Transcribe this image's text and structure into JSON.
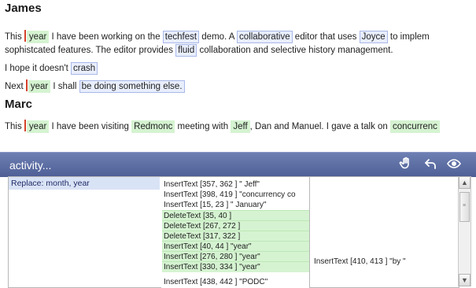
{
  "document": {
    "sections": [
      {
        "author": "James",
        "lines": [
          [
            {
              "t": "This ",
              "k": ""
            },
            {
              "t": "",
              "k": "bar"
            },
            {
              "t": "year",
              "k": "green"
            },
            {
              "t": " I have been working on the ",
              "k": ""
            },
            {
              "t": "techfest",
              "k": "blue"
            },
            {
              "t": " demo. A ",
              "k": ""
            },
            {
              "t": "collaborative",
              "k": "blue"
            },
            {
              "t": " editor that uses ",
              "k": ""
            },
            {
              "t": "Joyce",
              "k": "blue"
            },
            {
              "t": " to implem",
              "k": ""
            }
          ],
          [
            {
              "t": "sophistcated features. The editor provides ",
              "k": ""
            },
            {
              "t": "fluid",
              "k": "blue"
            },
            {
              "t": " collaboration and selective history management.",
              "k": ""
            }
          ],
          [
            {
              "t": "I hope it doesn't ",
              "k": ""
            },
            {
              "t": "crash",
              "k": "blue"
            }
          ],
          [
            {
              "t": "Next ",
              "k": ""
            },
            {
              "t": "",
              "k": "bar"
            },
            {
              "t": "year",
              "k": "green"
            },
            {
              "t": " I shall ",
              "k": ""
            },
            {
              "t": "be doing something else.",
              "k": "blue"
            }
          ]
        ]
      },
      {
        "author": "Marc",
        "lines": [
          [
            {
              "t": "This ",
              "k": ""
            },
            {
              "t": "",
              "k": "bar"
            },
            {
              "t": "year",
              "k": "green"
            },
            {
              "t": " I have been visiting ",
              "k": ""
            },
            {
              "t": "Redmonc",
              "k": "green"
            },
            {
              "t": " meeting with ",
              "k": ""
            },
            {
              "t": "Jeff",
              "k": "green"
            },
            {
              "t": ", Dan and Manuel. I gave a talk on ",
              "k": ""
            },
            {
              "t": "concurrenc",
              "k": "green"
            }
          ]
        ]
      }
    ]
  },
  "activity": {
    "title": "activity...",
    "icons": [
      "hand-icon",
      "undo-icon",
      "eye-icon"
    ],
    "operations": [
      "Replace: month, year"
    ],
    "history": [
      {
        "text": "InsertText [357, 362 ] \" Jeff\"",
        "highlight": false
      },
      {
        "text": "InsertText [398, 419 ] \"concurrency co",
        "highlight": false
      },
      {
        "text": "InsertText [15, 23 ] \" January\"",
        "highlight": false
      },
      {
        "text": "DeleteText [35, 40 ]",
        "highlight": true
      },
      {
        "text": "DeleteText [267, 272 ]",
        "highlight": true
      },
      {
        "text": "DeleteText [317, 322 ]",
        "highlight": true
      },
      {
        "text": "InsertText [40, 44 ] \"year\"",
        "highlight": true
      },
      {
        "text": "InsertText [276, 280 ] \"year\"",
        "highlight": true
      },
      {
        "text": "InsertText [330, 334 ] \"year\"",
        "highlight": true
      },
      {
        "text": "",
        "highlight": false
      },
      {
        "text": "InsertText [438, 442 ] \"PODC\"",
        "highlight": false
      }
    ],
    "detail": "InsertText [410, 413 ] \"by \""
  },
  "colors": {
    "header": "#5b6ba3",
    "insert_highlight": "#d5f3d1",
    "token_highlight": "#e8eefc",
    "caret": "#d5412a"
  }
}
